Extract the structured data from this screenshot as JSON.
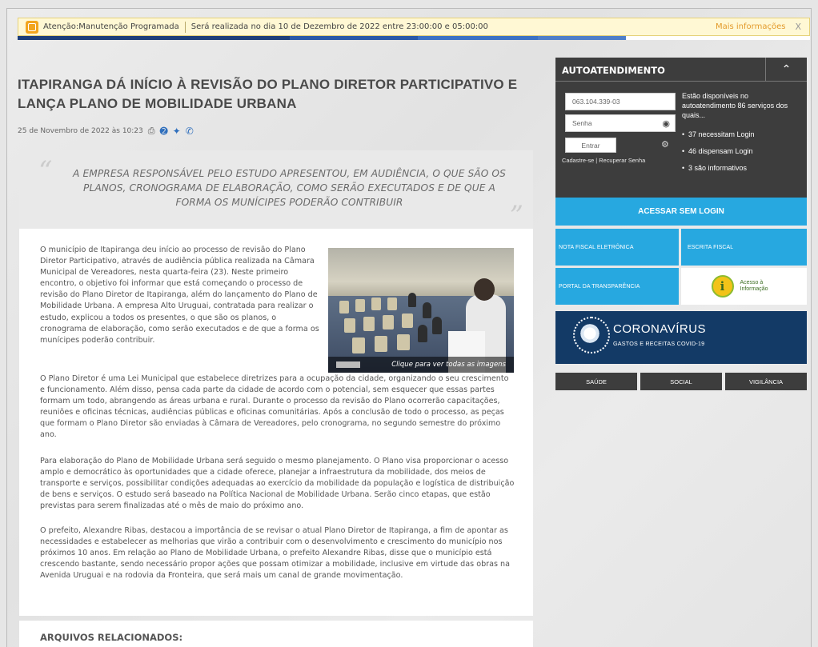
{
  "notice": {
    "title": "Atenção:Manutenção Programada",
    "message": "Será realizada no dia 10 de Dezembro de 2022 entre 23:00:00 e 05:00:00",
    "more_link": "Mais informações",
    "close": "X"
  },
  "article": {
    "title": "ITAPIRANGA DÁ INÍCIO À REVISÃO DO PLANO DIRETOR PARTICIPATIVO E LANÇA PLANO DE MOBILIDADE URBANA",
    "date": "25 de Novembro de 2022 às 10:23",
    "quote": "A EMPRESA RESPONSÁVEL PELO ESTUDO APRESENTOU, EM AUDIÊNCIA, O QUE SÃO OS PLANOS, CRONOGRAMA DE ELABORAÇÃO, COMO SERÃO EXECUTADOS E DE QUE A FORMA OS MUNÍCIPES PODERÃO CONTRIBUIR",
    "paragraph1": "O município de Itapiranga deu início ao processo de revisão do Plano Diretor Participativo, através de audiência pública realizada na Câmara Municipal de Vereadores, nesta quarta-feira (23). Neste primeiro encontro, o objetivo foi informar que está começando o processo de revisão do Plano Diretor de Itapiranga, além do lançamento do Plano de Mobilidade Urbana. A empresa Alto Uruguai, contratada para realizar o estudo, explicou a todos os presentes, o que são os planos, o cronograma de elaboração, como serão executados e de que a forma os munícipes poderão contribuir.",
    "paragraph2": "O Plano Diretor é uma Lei Municipal que estabelece diretrizes para a ocupação da cidade, organizando o seu crescimento e funcionamento. Além disso, pensa cada parte da cidade de acordo com o potencial, sem esquecer que essas partes formam um todo, abrangendo as áreas urbana e rural. Durante o processo da revisão do Plano ocorrerão capacitações, reuniões e oficinas técnicas, audiências públicas e oficinas comunitárias. Após a conclusão de todo o processo, as peças que formam o Plano Diretor são enviadas à Câmara de Vereadores, pelo cronograma, no segundo semestre do próximo ano.",
    "paragraph3": "Para elaboração do Plano de Mobilidade Urbana será seguido o mesmo planejamento. O Plano visa proporcionar o acesso amplo e democrático às oportunidades que a cidade oferece, planejar a infraestrutura da mobilidade, dos meios de transporte e serviços, possibilitar condições adequadas ao exercício da mobilidade da população e logística de distribuição de bens e serviços. O estudo será baseado na Política Nacional de Mobilidade Urbana. Serão cinco etapas, que estão previstas para serem finalizadas até o mês de maio do próximo ano.",
    "paragraph4": "O prefeito, Alexandre Ribas, destacou a importância de se revisar o atual Plano Diretor de Itapiranga, a fim de apontar as necessidades e estabelecer as melhorias que virão a contribuir com o desenvolvimento e crescimento do município nos próximos 10 anos. Em relação ao Plano de Mobilidade Urbana, o prefeito Alexandre Ribas, disse que o município está crescendo bastante, sendo necessário propor ações que possam otimizar a mobilidade, inclusive em virtude das obras na Avenida Uruguai e na rodovia da Fronteira, que será mais um canal de grande movimentação.",
    "photo_caption": "Clique para ver todas as imagens",
    "related_title": "ARQUIVOS RELACIONADOS:"
  },
  "sidebar": {
    "title": "AUTOATENDIMENTO",
    "cpf_value": "063.104.339-03",
    "password_placeholder": "Senha",
    "login_button": "Entrar",
    "links": "Cadastre-se | Recuperar Senha",
    "info_text": "Estão disponíveis no autoatendimento 86 serviços dos quais...",
    "info_items": [
      "37 necessitam Login",
      "46 dispensam Login",
      "3 são informativos"
    ],
    "access_button": "ACESSAR SEM LOGIN",
    "tiles": {
      "nota_fiscal": "NOTA FISCAL ELETRÔNICA",
      "escrita_fiscal": "ESCRITA FISCAL",
      "transparencia": "PORTAL DA TRANSPARÊNCIA",
      "acesso_info": "Acesso à Informação"
    },
    "corona_title": "CORONAVÍRUS",
    "corona_subtitle": "GASTOS E RECEITAS COVID-19",
    "categories": [
      "SAÚDE",
      "SOCIAL",
      "VIGILÂNCIA"
    ]
  },
  "colors": {
    "accent_blue": "#27a8e0",
    "dark_panel": "#3d3d3d",
    "corona_navy": "#133a66",
    "notice_link": "#e39a2b"
  }
}
